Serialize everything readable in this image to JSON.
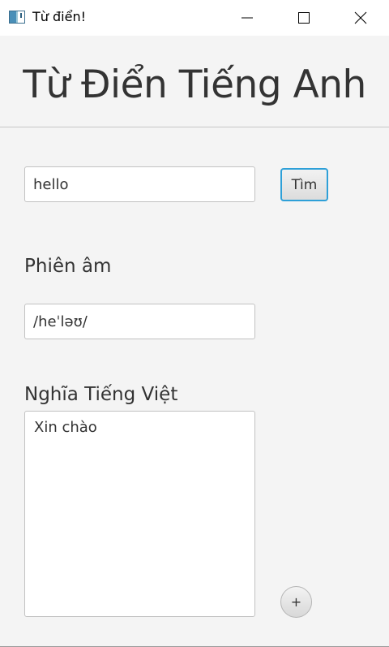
{
  "window": {
    "title": "Từ điển!"
  },
  "header": {
    "title": "Từ Điển Tiếng Anh"
  },
  "search": {
    "value": "hello",
    "button_label": "Tìm"
  },
  "phonetic": {
    "label": "Phiên âm",
    "value": "/heˈləʊ/"
  },
  "meaning": {
    "label": "Nghĩa Tiếng Việt",
    "value": "Xin chào"
  },
  "add_button": {
    "label": "+"
  },
  "colors": {
    "focus_accent": "#2ea0d8",
    "background": "#f4f4f4"
  }
}
